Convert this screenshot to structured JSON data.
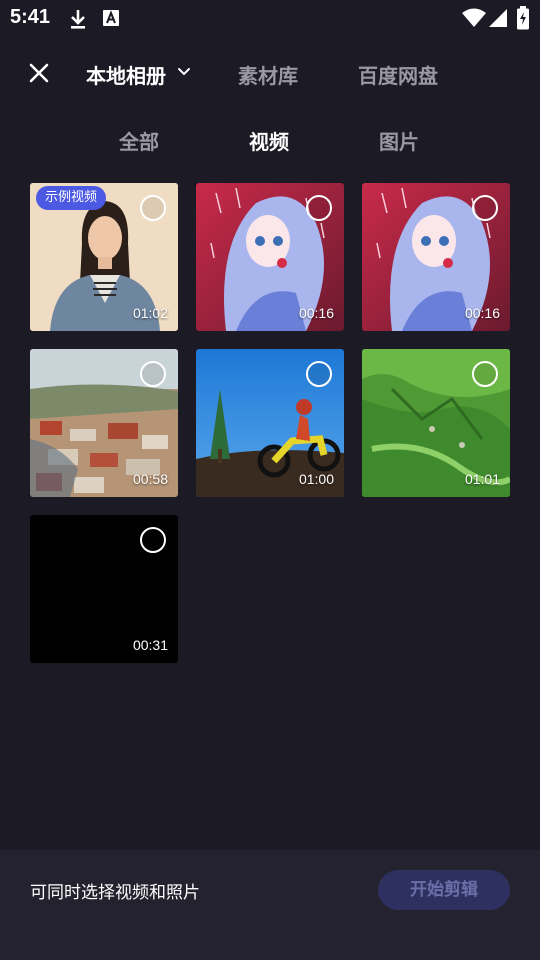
{
  "status_bar": {
    "time": "5:41",
    "icons": [
      "download-icon",
      "font-a-icon",
      "wifi-icon",
      "signal-icon",
      "battery-charging-icon"
    ]
  },
  "top_nav": {
    "close_icon": "close-icon",
    "sources": [
      {
        "label": "本地相册",
        "active": true
      },
      {
        "label": "素材库",
        "active": false
      },
      {
        "label": "百度网盘",
        "active": false
      }
    ],
    "dropdown_icon": "chevron-down-icon"
  },
  "type_tabs": [
    {
      "label": "全部",
      "active": false
    },
    {
      "label": "视频",
      "active": true
    },
    {
      "label": "图片",
      "active": false
    }
  ],
  "media": [
    {
      "duration": "01:02",
      "badge": "示例视频",
      "thumb": "woman-portrait"
    },
    {
      "duration": "00:16",
      "badge": "",
      "thumb": "anime-girl"
    },
    {
      "duration": "00:16",
      "badge": "",
      "thumb": "anime-girl"
    },
    {
      "duration": "00:58",
      "badge": "",
      "thumb": "town-aerial"
    },
    {
      "duration": "01:00",
      "badge": "",
      "thumb": "motocross"
    },
    {
      "duration": "01:01",
      "badge": "",
      "thumb": "green-hills"
    },
    {
      "duration": "00:31",
      "badge": "",
      "thumb": "black"
    }
  ],
  "bottom_bar": {
    "hint": "可同时选择视频和照片",
    "start_button": "开始剪辑"
  },
  "colors": {
    "background": "#1b1a25",
    "bottom_bar": "#23222e",
    "badge": "#4b59e3",
    "start_button_bg": "#2e3160",
    "start_button_text": "#6b6fa8",
    "inactive_text": "#9a99a3"
  }
}
